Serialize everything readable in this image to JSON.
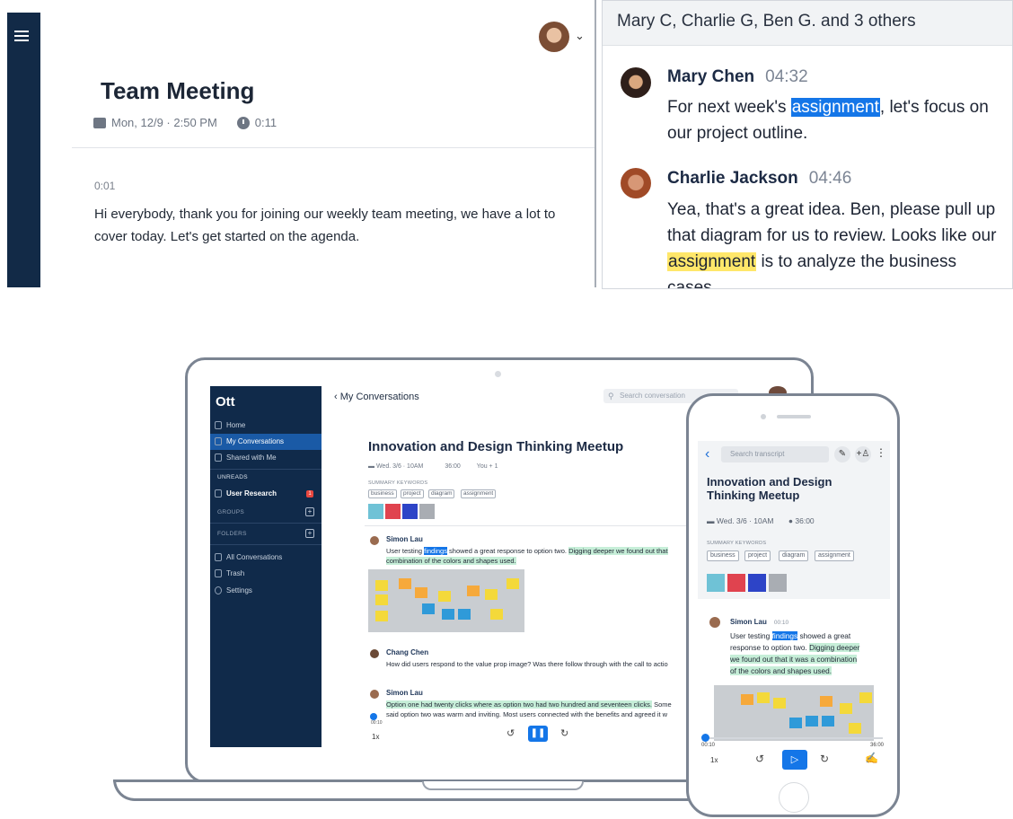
{
  "top_left": {
    "title": "Team Meeting",
    "date": "Mon, 12/9 · 2:50 PM",
    "duration": "0:11",
    "timestamp": "0:01",
    "transcript": "Hi everybody, thank you for joining our weekly team meeting, we have a lot to cover today. Let's get started on the agenda."
  },
  "top_right": {
    "header": "Mary C, Charlie G, Ben G. and 3 others",
    "messages": [
      {
        "name": "Mary Chen",
        "time": "04:32",
        "pre": "For next week's ",
        "highlight": "assignment",
        "post": ", let's focus on our project outline."
      },
      {
        "name": "Charlie Jackson",
        "time": "04:46",
        "pre": "Yea, that's a great idea. Ben, please pull up that diagram for us to review. Looks like our ",
        "highlight": "assignment",
        "post": " is to analyze the business cases"
      }
    ]
  },
  "laptop": {
    "logo": "Ott",
    "nav": {
      "home": "Home",
      "my_conversations": "My Conversations",
      "shared": "Shared with Me",
      "all": "All Conversations",
      "trash": "Trash",
      "settings": "Settings"
    },
    "sections": {
      "unreads": "UNREADS",
      "groups": "GROUPS",
      "folders": "FOLDERS"
    },
    "unread_item": "User Research",
    "unread_count": "1",
    "plus": "+",
    "back_label": "‹ My Conversations",
    "search_placeholder": "Search conversation",
    "title": "Innovation and Design Thinking Meetup",
    "date": "Wed. 3/6 · 10AM",
    "duration": "36:00",
    "participants": "You + 1",
    "keywords_label": "SUMMARY KEYWORDS",
    "keywords": [
      "business",
      "project",
      "diagram",
      "assignment"
    ],
    "msg1": {
      "name": "Simon Lau",
      "l1a": "User testing ",
      "l1b": "findings",
      "l1c": " showed a great response to option two. ",
      "l1d": "Digging deeper we found out that",
      "l2": "combination of the colors and shapes used."
    },
    "msg2": {
      "name": "Chang Chen",
      "text": "How did users respond to the value prop image? Was there follow through with the call to actio"
    },
    "msg3": {
      "name": "Simon Lau",
      "l1a": "Option one had twenty clicks where as option two had two hundred and seventeen clicks.",
      "l1b": " Some",
      "l2": "said option two was warm and inviting. Most users connected with the benefits and agreed it w"
    },
    "speed": "1x",
    "time_start": "00:10",
    "play": "❚❚",
    "rewind": "↺",
    "forward": "↻"
  },
  "phone": {
    "back": "‹",
    "search_placeholder": "Search transcript",
    "edit": "✎",
    "add_person": "+♙",
    "more": "⋮",
    "title": "Innovation and Design Thinking Meetup",
    "date": "Wed. 3/6 · 10AM",
    "duration": "36:00",
    "keywords_label": "SUMMARY KEYWORDS",
    "keywords": [
      "business",
      "project",
      "diagram",
      "assignment"
    ],
    "msg_name": "Simon Lau",
    "msg_time": "00:10",
    "line1a": "User testing ",
    "line1b": "findings",
    "line1c": " showed a great",
    "line2a": "response to option two. ",
    "line2b": "Digging deeper",
    "line3": "we found out that it was a combination",
    "line4": "of the colors and shapes used.",
    "time_start": "00:10",
    "time_end": "36:00",
    "speed": "1x",
    "rewind": "↺",
    "play": "▷",
    "forward": "↻",
    "pen": "✍"
  },
  "colors": {
    "navy": "#102a4a",
    "accent": "#1476e8",
    "highlight_yellow": "#ffe76a",
    "highlight_green": "#c6eed8"
  }
}
